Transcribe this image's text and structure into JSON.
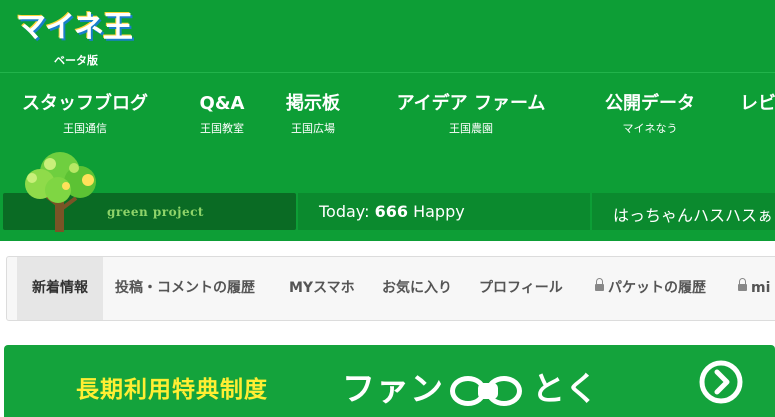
{
  "logo": {
    "text": "マイネ王",
    "subtitle": "ベータ版"
  },
  "nav": [
    {
      "label": "スタッフブログ",
      "sub": "王国通信"
    },
    {
      "label": "Q&A",
      "sub": "王国教室"
    },
    {
      "label": "掲示板",
      "sub": "王国広場"
    },
    {
      "label": "アイデア ファーム",
      "sub": "王国農園"
    },
    {
      "label": "公開データ",
      "sub": "マイネなう"
    },
    {
      "label": "レビ",
      "sub": ""
    }
  ],
  "green_project": {
    "label": "green project"
  },
  "today": {
    "prefix": "Today:",
    "count": "666",
    "suffix": "Happy"
  },
  "ticker": {
    "text": "はっちゃんハスハスぁ"
  },
  "tabs": [
    {
      "label": "新着情報",
      "active": true,
      "locked": false
    },
    {
      "label": "投稿・コメントの履歴",
      "active": false,
      "locked": false
    },
    {
      "label": "MYスマホ",
      "active": false,
      "locked": false
    },
    {
      "label": "お気に入り",
      "active": false,
      "locked": false
    },
    {
      "label": "プロフィール",
      "active": false,
      "locked": false
    },
    {
      "label": "パケットの履歴",
      "active": false,
      "locked": true
    },
    {
      "label": "mi",
      "active": false,
      "locked": true
    }
  ],
  "banner": {
    "left_text": "長期利用特典制度",
    "right_text_a": "ファン",
    "right_text_b": "とく",
    "go_icon": "chevron-right-circle-icon"
  },
  "colors": {
    "header_green": "#0d9e36",
    "banner_yellow": "#ffee33"
  }
}
